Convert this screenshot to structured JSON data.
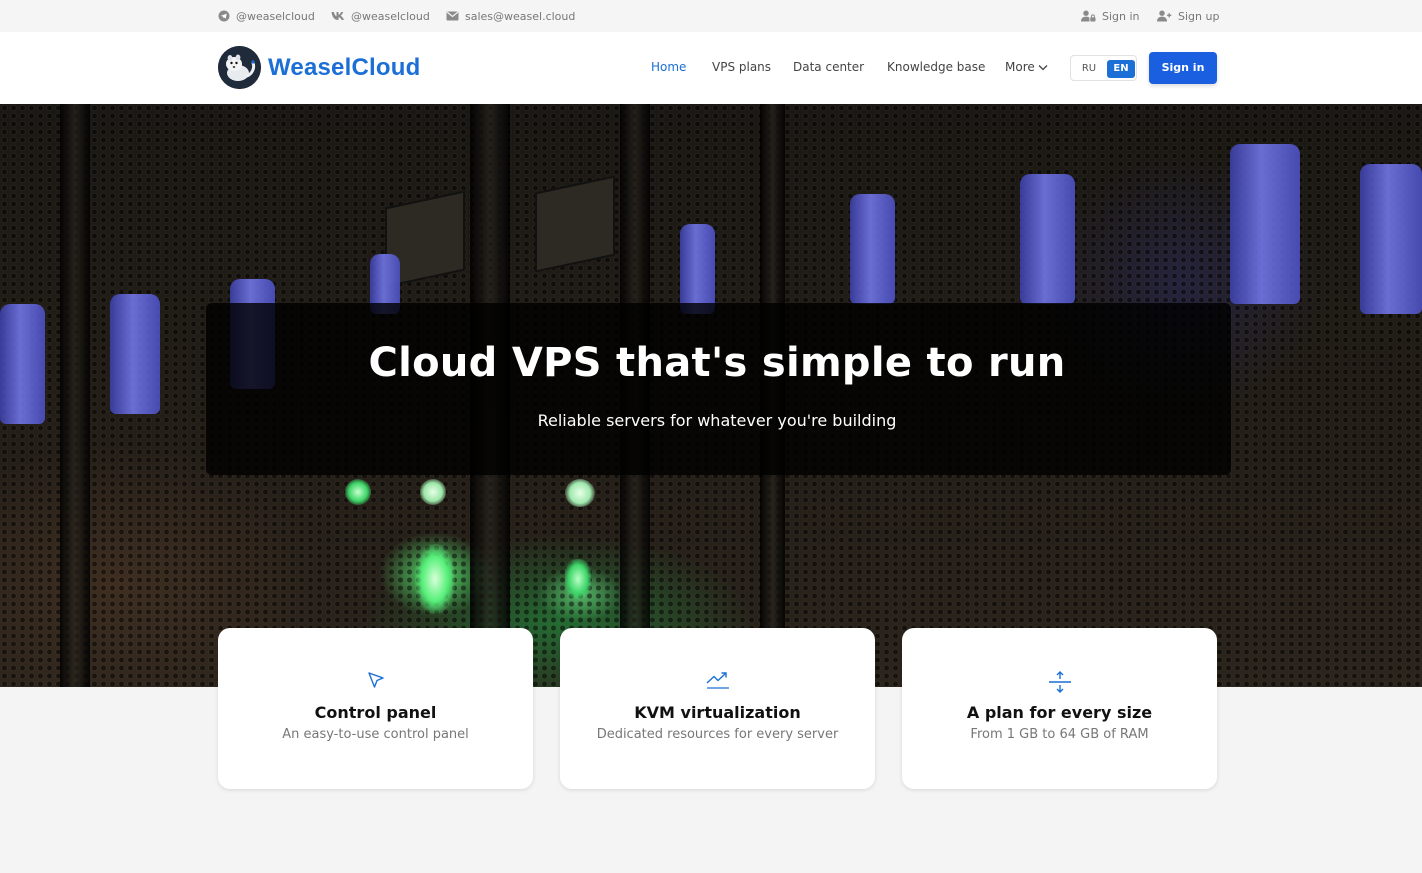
{
  "topbar": {
    "telegram": "@weaselcloud",
    "vk": "@weaselcloud",
    "email": "sales@weasel.cloud",
    "signin": "Sign in",
    "signup": "Sign up"
  },
  "nav": {
    "brand": "WeaselCloud",
    "links": [
      "Home",
      "VPS plans",
      "Data center",
      "Knowledge base"
    ],
    "more": "More",
    "lang_ru": "RU",
    "lang_en": "EN",
    "signin_button": "Sign in"
  },
  "hero": {
    "title": "Cloud VPS that's simple to run",
    "subtitle": "Reliable servers for whatever you're building"
  },
  "features": [
    {
      "icon": "cursor-arrow-icon",
      "title": "Control panel",
      "desc": "An easy-to-use control panel"
    },
    {
      "icon": "trending-up-icon",
      "title": "KVM virtualization",
      "desc": "Dedicated resources for every server"
    },
    {
      "icon": "expand-vertical-icon",
      "title": "A plan for every size",
      "desc": "From 1 GB to 64 GB of RAM"
    }
  ],
  "colors": {
    "brand": "#1b6fd6",
    "button": "#1a5fe0"
  }
}
